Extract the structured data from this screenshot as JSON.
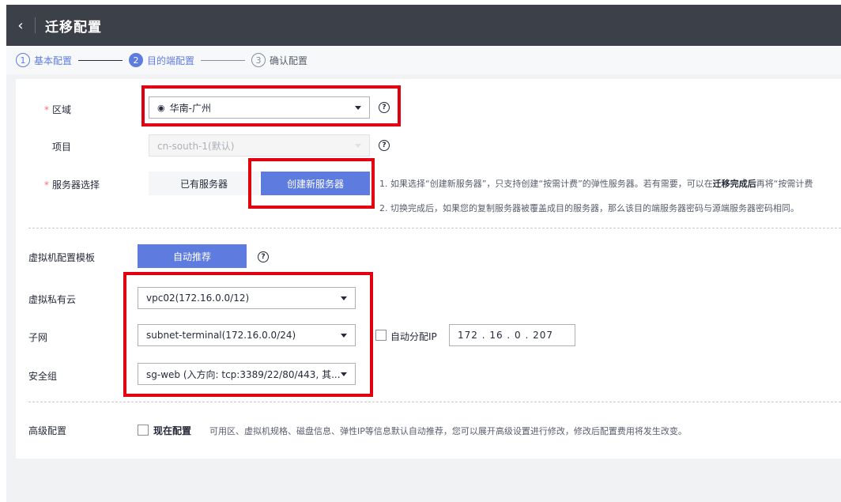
{
  "header": {
    "back_icon": "‹",
    "title": "迁移配置"
  },
  "steps": [
    {
      "num": "1",
      "label": "基本配置"
    },
    {
      "num": "2",
      "label": "目的端配置"
    },
    {
      "num": "3",
      "label": "确认配置"
    }
  ],
  "region": {
    "label": "区域",
    "value": "华南-广州",
    "pin_icon": "location-pin"
  },
  "project": {
    "label": "项目",
    "value": "cn-south-1(默认)"
  },
  "server": {
    "label": "服务器选择",
    "existing_label": "已有服务器",
    "create_label": "创建新服务器",
    "note1_a": "1. 如果选择“创建新服务器”，只支持创建“按需计费”的弹性服务器。若有需要，可以在",
    "note1_bold": "迁移完成后",
    "note1_b": "再将“按需计费",
    "note2": "2. 切换完成后，如果您的复制服务器被覆盖成目的服务器，那么该目的端服务器密码与源端服务器密码相同。"
  },
  "template": {
    "label": "虚拟机配置模板",
    "button": "自动推荐"
  },
  "vpc": {
    "label": "虚拟私有云",
    "value": "vpc02(172.16.0.0/12)"
  },
  "subnet": {
    "label": "子网",
    "value": "subnet-terminal(172.16.0.0/24)",
    "auto_ip_label": "自动分配IP",
    "ip": "172  .  16  .  0  .  207"
  },
  "security": {
    "label": "安全组",
    "value": "sg-web (入方向: tcp:3389/22/80/443, 其..."
  },
  "advanced": {
    "label": "高级配置",
    "check_label": "现在配置",
    "desc": "可用区、虚拟机规格、磁盘信息、弹性IP等信息默认自动推荐，您可以展开高级设置进行修改，修改后配置费用将发生改变。"
  },
  "help_glyph": "?",
  "colors": {
    "primary": "#5e7ce0",
    "header_bg": "#3b4049",
    "required_star": "#f66f6a",
    "highlight_box": "#e1000f"
  }
}
